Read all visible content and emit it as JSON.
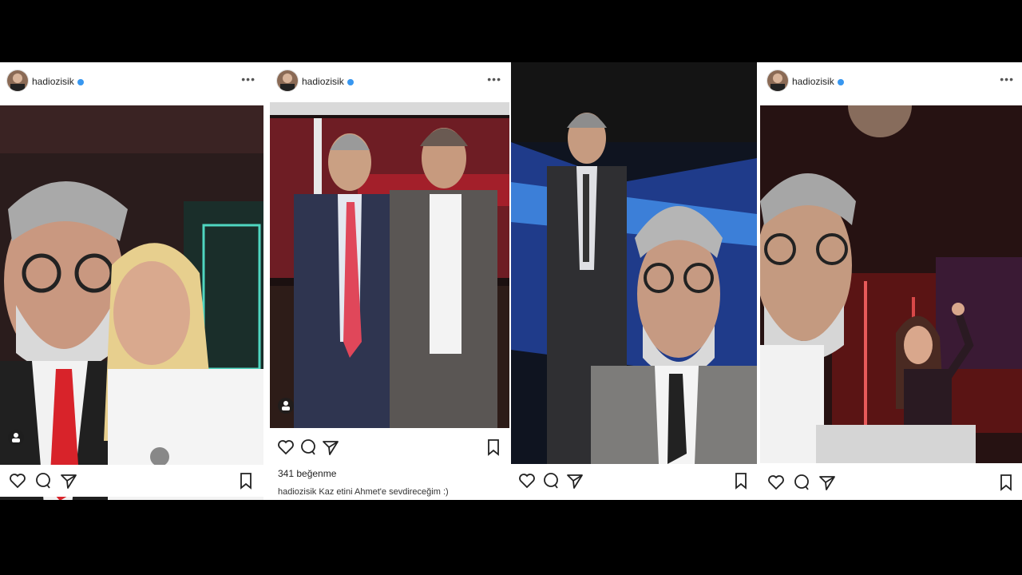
{
  "posts": [
    {
      "username": "hadiozisik",
      "more_label": "•••",
      "icons": [
        "heart-icon",
        "comment-icon",
        "share-icon",
        "bookmark-icon",
        "user-tag-icon"
      ]
    },
    {
      "username": "hadiozisik",
      "more_label": "•••",
      "likes": "341 beğenme",
      "caption_user": "hadiozisik",
      "caption_text": "Kaz etini Ahmet'e sevdireceğim :)",
      "icons": [
        "heart-icon",
        "comment-icon",
        "share-icon",
        "bookmark-icon",
        "user-tag-icon"
      ]
    },
    {
      "icons": [
        "heart-icon",
        "comment-icon",
        "share-icon",
        "bookmark-icon"
      ]
    },
    {
      "username": "hadiozisik",
      "more_label": "•••",
      "icons": [
        "heart-icon",
        "comment-icon",
        "share-icon",
        "bookmark-icon"
      ]
    }
  ],
  "colors": {
    "verified": "#3897f0",
    "background": "#000000",
    "card": "#ffffff"
  }
}
